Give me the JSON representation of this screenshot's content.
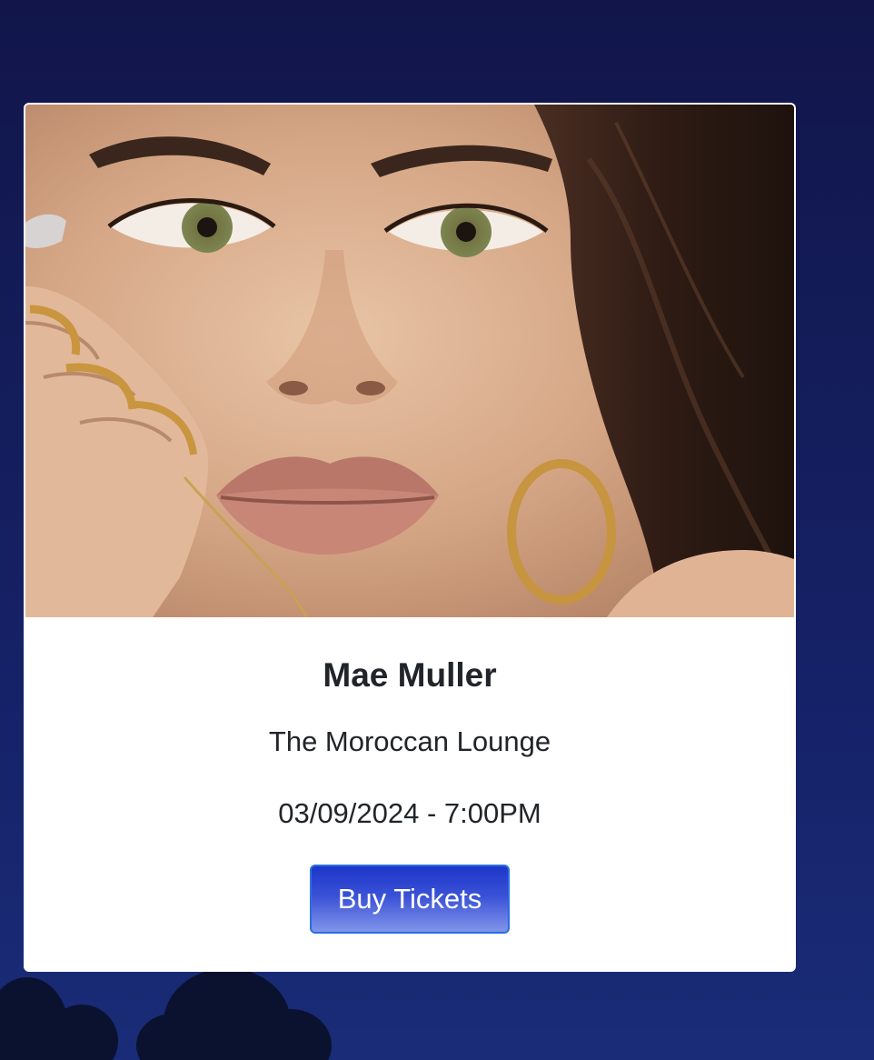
{
  "event": {
    "artist": "Mae Muller",
    "venue": "The Moroccan Lounge",
    "datetime": "03/09/2024 - 7:00PM",
    "buy_label": "Buy Tickets",
    "photo_alt": "Mae Muller"
  },
  "colors": {
    "background": "#141d5a",
    "card": "#ffffff",
    "text": "#212529",
    "button": "#2f47d2",
    "button_border": "#2d6fe0"
  }
}
